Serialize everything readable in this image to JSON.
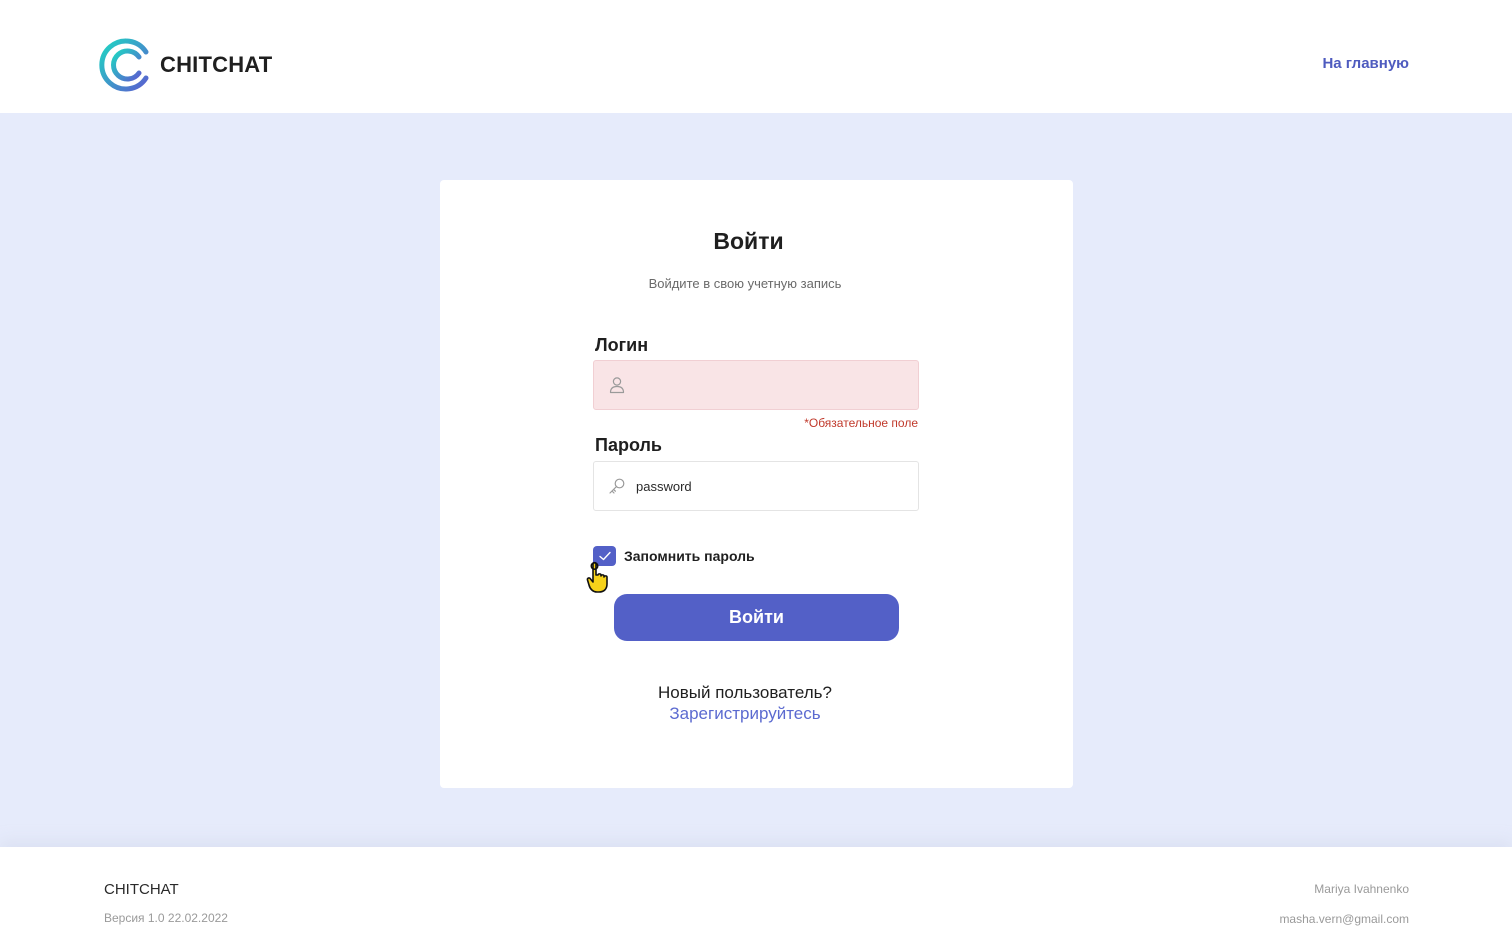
{
  "header": {
    "logo_text": "CHITCHAT",
    "home_link": "На главную"
  },
  "login_card": {
    "title": "Войти",
    "subtitle": "Войдите в свою учетную запись",
    "login_label": "Логин",
    "login_value": "",
    "login_icon": "user-icon",
    "login_error": "*Обязательное поле",
    "password_label": "Пароль",
    "password_value": "password",
    "password_icon": "key-icon",
    "remember_label": "Запомнить пароль",
    "remember_checked": true,
    "submit_label": "Войти",
    "new_user_text": "Новый пользователь?",
    "register_link": "Зарегистрируйтесь"
  },
  "footer": {
    "brand": "CHITCHAT",
    "version": "Версия 1.0 22.02.2022",
    "author": "Mariya Ivahnenko",
    "email": "masha.vern@gmail.com"
  },
  "colors": {
    "accent": "#5360c7",
    "link": "#5b6ad0",
    "background": "#e6ebfb",
    "error": "#c0392b",
    "error_field_bg": "#f9e4e6",
    "logo_gradient_start": "#1fd1c4",
    "logo_gradient_end": "#5a5fd0"
  }
}
